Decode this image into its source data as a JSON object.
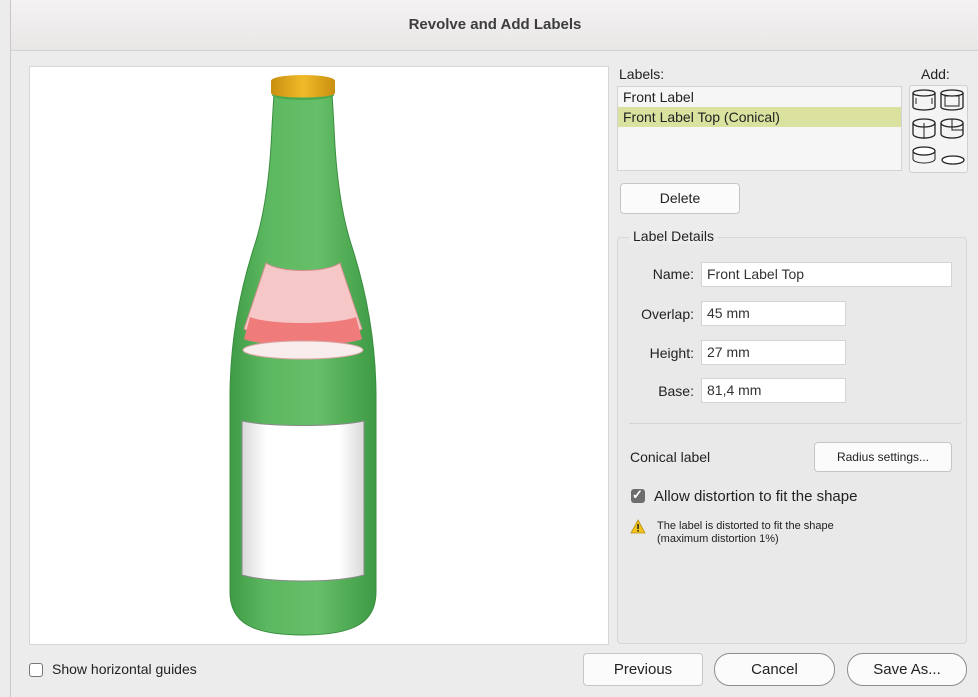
{
  "window": {
    "title": "Revolve and Add Labels"
  },
  "labels_panel": {
    "labels_heading": "Labels:",
    "add_heading": "Add:",
    "items": [
      {
        "label": "Front Label",
        "selected": false
      },
      {
        "label": "Front Label Top (Conical)",
        "selected": true
      }
    ],
    "delete_button": "Delete"
  },
  "details": {
    "group_label": "Label Details",
    "name_label": "Name:",
    "name_value": "Front Label Top",
    "overlap_label": "Overlap:",
    "overlap_value": "45 mm",
    "height_label": "Height:",
    "height_value": "27 mm",
    "base_label": "Base:",
    "base_value": "81,4 mm",
    "conical_label": "Conical label",
    "radius_button": "Radius settings...",
    "allow_distortion_label": "Allow distortion to fit the shape",
    "allow_distortion_checked": true,
    "warning_line1": "The label is distorted to fit the shape",
    "warning_line2": "(maximum distortion 1%)"
  },
  "footer": {
    "show_guides_label": "Show horizontal guides",
    "show_guides_checked": false,
    "previous_button": "Previous",
    "cancel_button": "Cancel",
    "save_as_button": "Save As..."
  },
  "colors": {
    "bottle_green": "#5cb860",
    "cap_yellow": "#e3ad1b",
    "selected_row": "#dbe2a0",
    "conical_label_red": "#f07b7b"
  }
}
